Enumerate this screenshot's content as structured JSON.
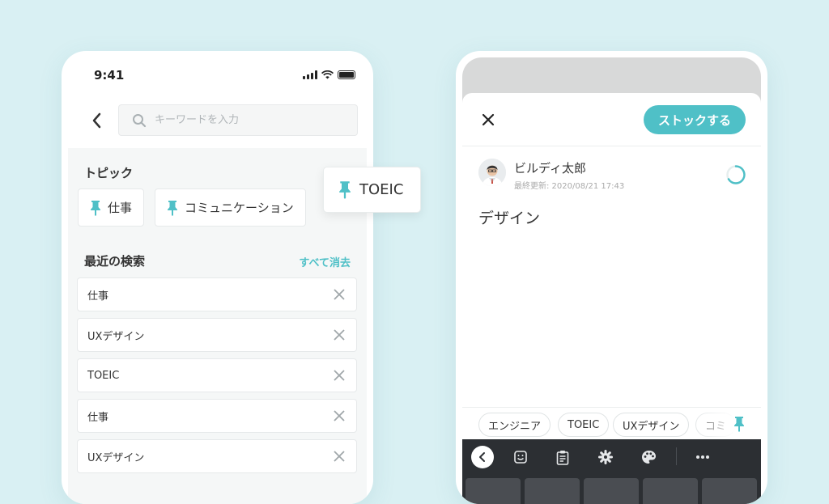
{
  "left_screen": {
    "status_time": "9:41",
    "search": {
      "placeholder": "キーワードを入力"
    },
    "topics": {
      "title": "トピック",
      "items": [
        {
          "label": "仕事",
          "icon": "pin-icon"
        },
        {
          "label": "コミュニケーション",
          "icon": "pin-icon"
        }
      ]
    },
    "recent": {
      "title": "最近の検索",
      "clear_all": "すべて消去",
      "items": [
        {
          "label": "仕事"
        },
        {
          "label": "UXデザイン"
        },
        {
          "label": "TOEIC"
        },
        {
          "label": "仕事"
        },
        {
          "label": "UXデザイン"
        }
      ]
    }
  },
  "floating_chip": {
    "label": "TOEIC",
    "icon": "pin-icon"
  },
  "right_screen": {
    "stock_button": "ストックする",
    "author": {
      "name": "ビルディ太郎",
      "updated": "最終更新: 2020/08/21 17:43"
    },
    "title": "デザイン",
    "tags": [
      {
        "label": "エンジニア"
      },
      {
        "label": "TOEIC"
      },
      {
        "label": "UXデザイン"
      },
      {
        "label": "コミ"
      }
    ],
    "keyboard_toolbar": {
      "icons": [
        "chevron-left-icon",
        "emoji-icon",
        "clipboard-icon",
        "gear-icon",
        "palette-icon",
        "more-icon"
      ]
    }
  },
  "colors": {
    "background": "#d9f0f3",
    "accent": "#4fc0c7",
    "pin": "#4fc0c7",
    "keyboard": "#2c2f33"
  }
}
